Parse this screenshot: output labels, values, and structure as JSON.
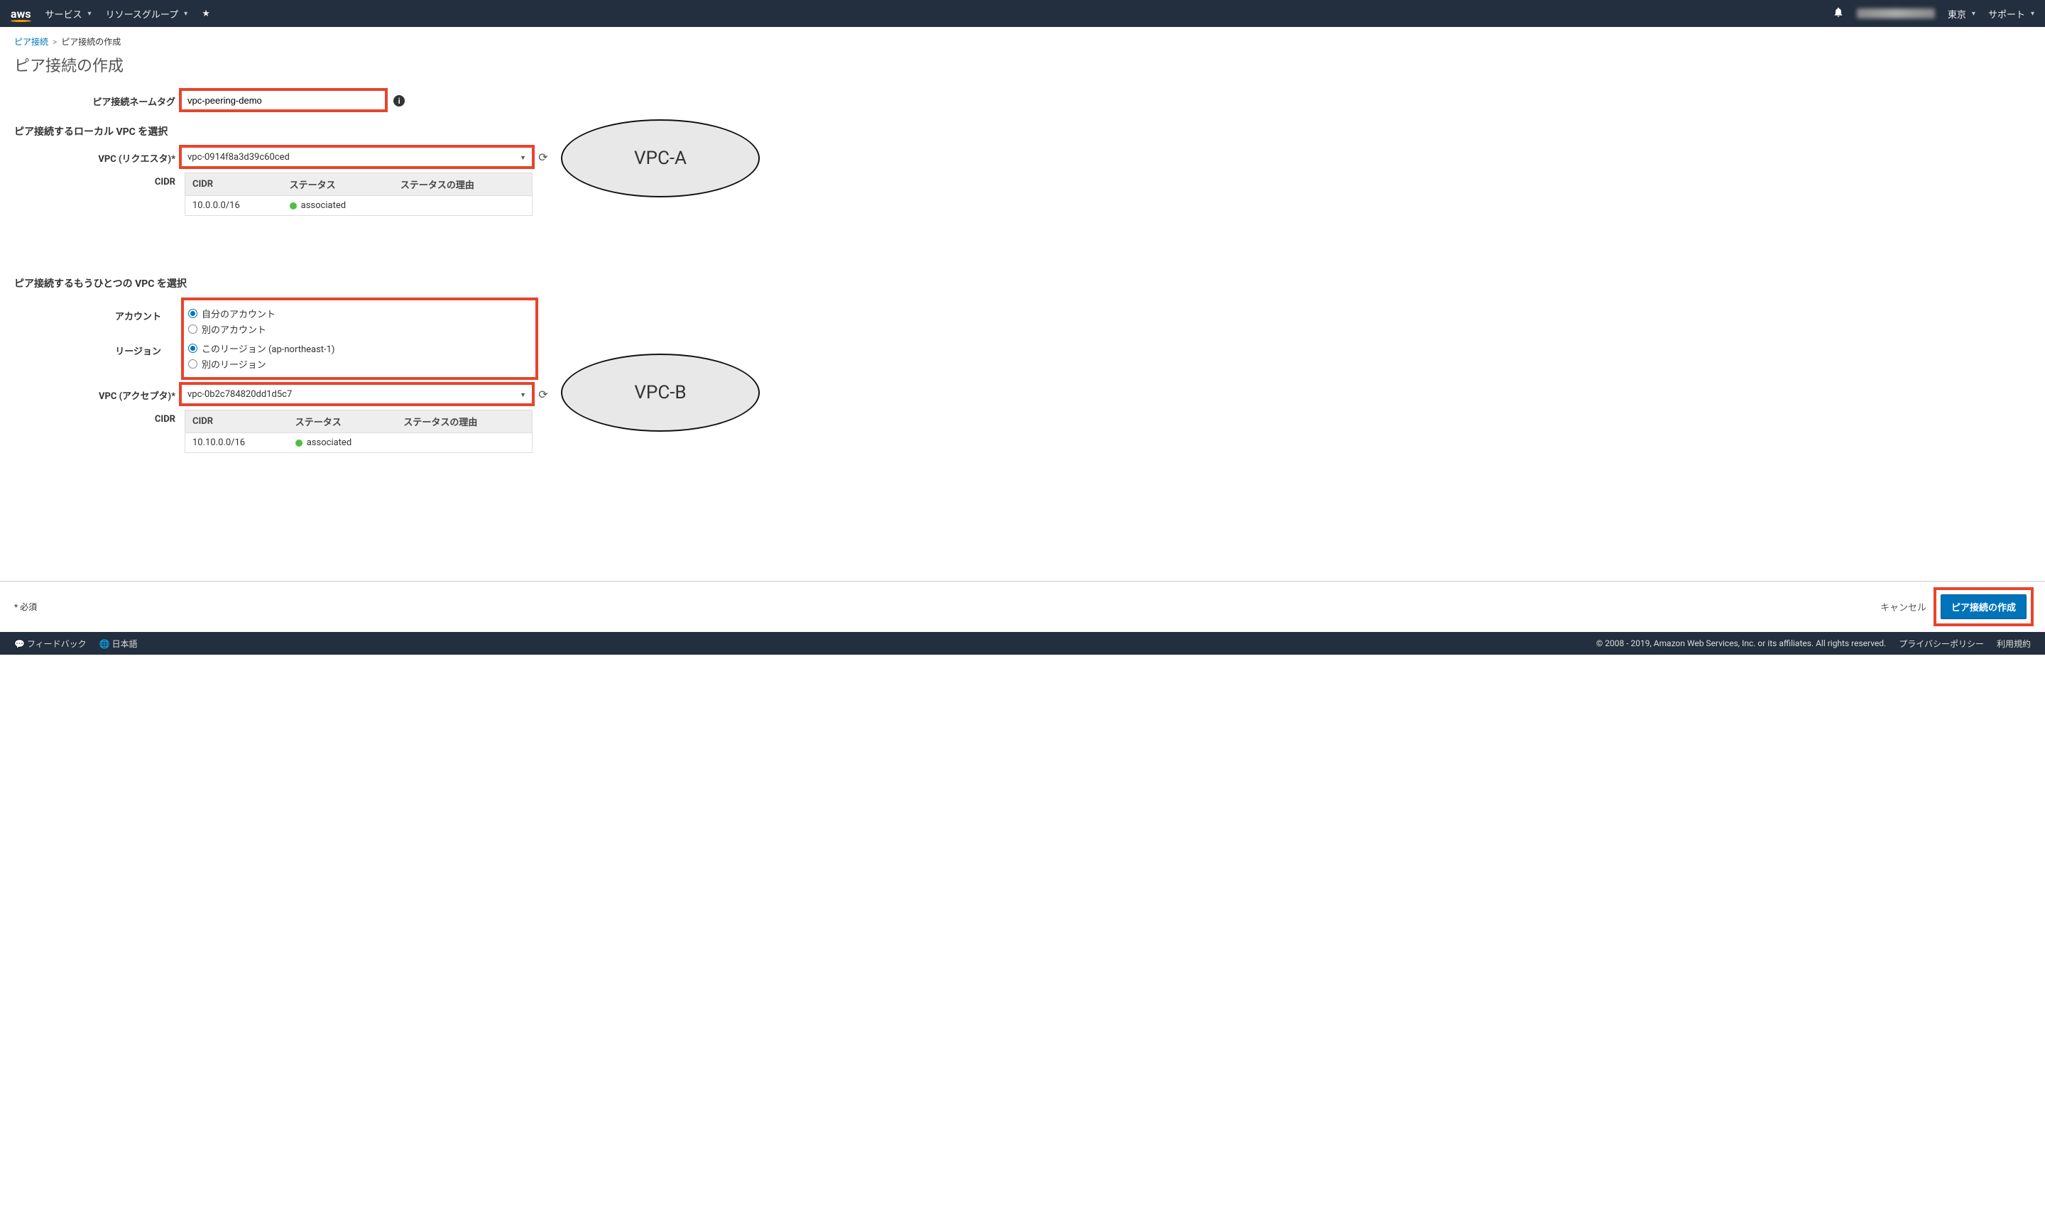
{
  "top_nav": {
    "logo": "aws",
    "services": "サービス",
    "resource_groups": "リソースグループ",
    "region": "東京",
    "support": "サポート"
  },
  "breadcrumb": {
    "parent": "ピア接続",
    "current": "ピア接続の作成"
  },
  "page_title": "ピア接続の作成",
  "name_tag": {
    "label": "ピア接続ネームタグ",
    "value": "vpc-peering-demo"
  },
  "requester_section": {
    "header": "ピア接続するローカル VPC を選択",
    "vpc_label": "VPC (リクエスタ)*",
    "vpc_value": "vpc-0914f8a3d39c60ced",
    "cidr_label": "CIDR",
    "table_headers": {
      "cidr": "CIDR",
      "status": "ステータス",
      "status_reason": "ステータスの理由"
    },
    "cidr_rows": [
      {
        "cidr": "10.0.0.0/16",
        "status": "associated",
        "reason": ""
      }
    ]
  },
  "accepter_section": {
    "header": "ピア接続するもうひとつの VPC を選択",
    "account_label": "アカウント",
    "account_options": {
      "my": "自分のアカウント",
      "other": "別のアカウント"
    },
    "region_label": "リージョン",
    "region_options": {
      "this": "このリージョン (ap-northeast-1)",
      "other": "別のリージョン"
    },
    "vpc_label": "VPC (アクセプタ)*",
    "vpc_value": "vpc-0b2c784820dd1d5c7",
    "cidr_label": "CIDR",
    "table_headers": {
      "cidr": "CIDR",
      "status": "ステータス",
      "status_reason": "ステータスの理由"
    },
    "cidr_rows": [
      {
        "cidr": "10.10.0.0/16",
        "status": "associated",
        "reason": ""
      }
    ]
  },
  "callouts": {
    "a": "VPC-A",
    "b": "VPC-B"
  },
  "actions": {
    "required": "* 必須",
    "cancel": "キャンセル",
    "create": "ピア接続の作成"
  },
  "footer": {
    "feedback": "フィードバック",
    "language": "日本語",
    "copyright": "© 2008 - 2019, Amazon Web Services, Inc. or its affiliates. All rights reserved.",
    "privacy": "プライバシーポリシー",
    "terms": "利用規約"
  }
}
